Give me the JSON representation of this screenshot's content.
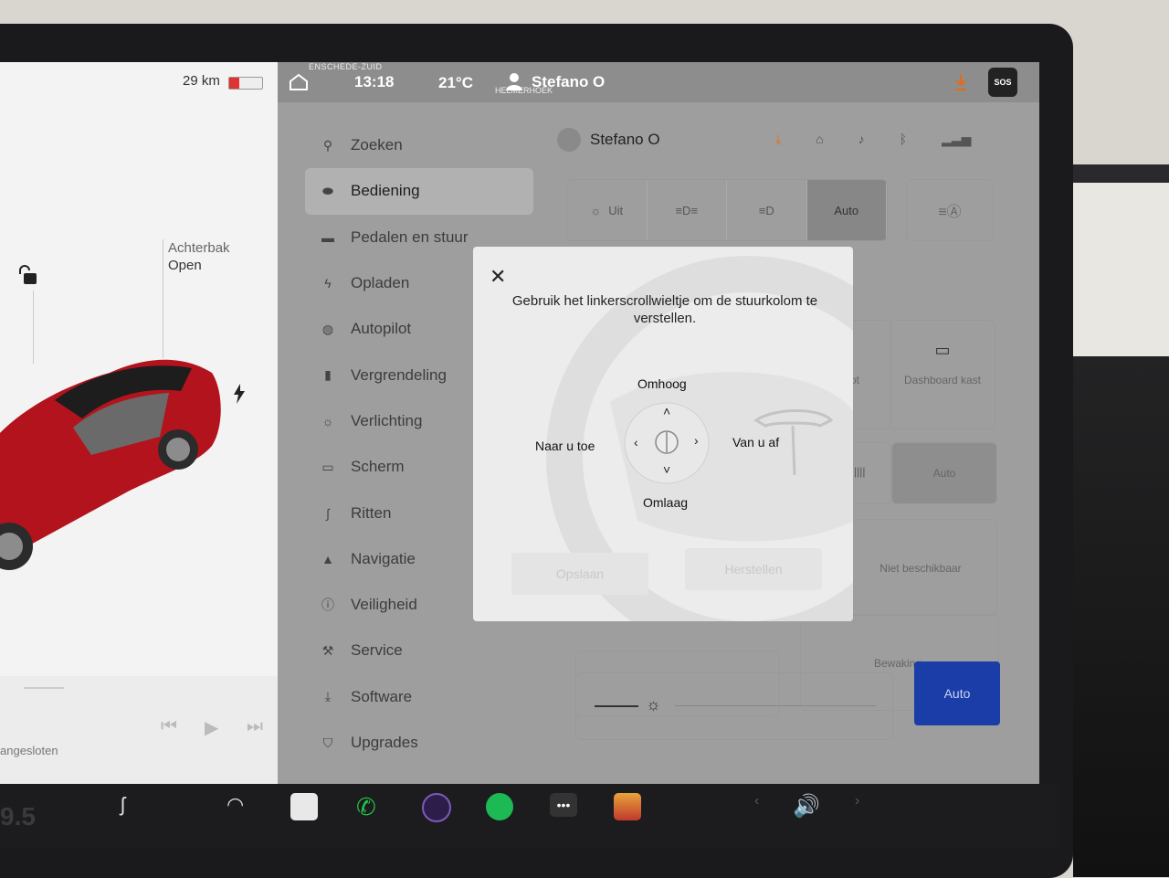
{
  "car_panel": {
    "range": "29 km",
    "battery_level": 0.3,
    "trunk_label": "Achterbak",
    "trunk_status": "Open",
    "media_status": "angesloten"
  },
  "topbar": {
    "location": "ENSCHEDE-ZUID",
    "sublocation": "HELMERHOEK",
    "time": "13:18",
    "temperature": "21°C",
    "user": "Stefano O",
    "sos": "SOS"
  },
  "menu": {
    "items": [
      {
        "label": "Zoeken",
        "icon": "search-icon",
        "glyph": "⚲"
      },
      {
        "label": "Bediening",
        "icon": "toggle-icon",
        "glyph": "⬬"
      },
      {
        "label": "Pedalen en stuur",
        "icon": "car-icon",
        "glyph": "▬"
      },
      {
        "label": "Opladen",
        "icon": "bolt-icon",
        "glyph": "ϟ"
      },
      {
        "label": "Autopilot",
        "icon": "steering-wheel-icon",
        "glyph": "◍"
      },
      {
        "label": "Vergrendeling",
        "icon": "lock-icon",
        "glyph": "▮"
      },
      {
        "label": "Verlichting",
        "icon": "sun-icon",
        "glyph": "☼"
      },
      {
        "label": "Scherm",
        "icon": "display-icon",
        "glyph": "▭"
      },
      {
        "label": "Ritten",
        "icon": "trips-icon",
        "glyph": "∫"
      },
      {
        "label": "Navigatie",
        "icon": "navigation-icon",
        "glyph": "▲"
      },
      {
        "label": "Veiligheid",
        "icon": "safety-icon",
        "glyph": "ⓘ"
      },
      {
        "label": "Service",
        "icon": "wrench-icon",
        "glyph": "🔧"
      },
      {
        "label": "Software",
        "icon": "download-icon",
        "glyph": "⤓"
      },
      {
        "label": "Upgrades",
        "icon": "bag-icon",
        "glyph": "⛉"
      }
    ]
  },
  "controls": {
    "profile_name": "Stefano O",
    "lights": [
      "Uit",
      "",
      "",
      "Auto"
    ],
    "dashboard_label": "Dashboard kast",
    "partial_label": "ot",
    "wiper_auto": "Auto",
    "not_available": "Niet beschikbaar",
    "bewaking": "Bewaking",
    "brightness_auto": "Auto"
  },
  "modal": {
    "message": "Gebruik het linkerscrollwieltje om de stuurkolom te verstellen.",
    "up": "Omhoog",
    "down": "Omlaag",
    "toward": "Naar u toe",
    "away": "Van u af",
    "save": "Opslaan",
    "reset": "Herstellen"
  },
  "colors": {
    "accent_blue": "#1a3da8",
    "car_red": "#b3131c"
  }
}
